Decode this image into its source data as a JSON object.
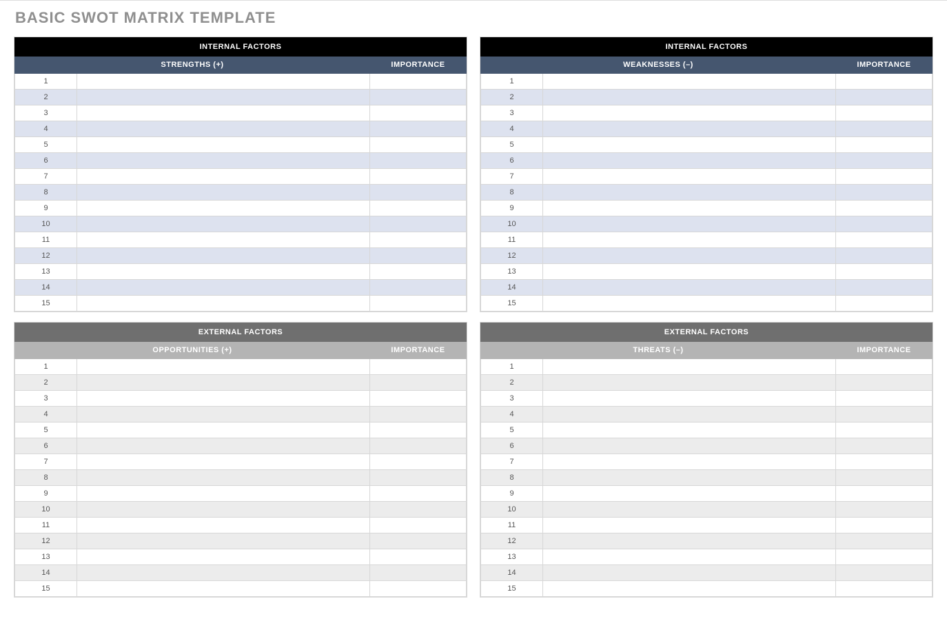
{
  "title": "BASIC SWOT MATRIX TEMPLATE",
  "row_count": 15,
  "quadrants": [
    {
      "id": "strengths",
      "section": "internal",
      "category_header": "INTERNAL FACTORS",
      "item_header": "STRENGTHS (+)",
      "importance_header": "IMPORTANCE"
    },
    {
      "id": "weaknesses",
      "section": "internal",
      "category_header": "INTERNAL FACTORS",
      "item_header": "WEAKNESSES (–)",
      "importance_header": "IMPORTANCE"
    },
    {
      "id": "opportunities",
      "section": "external",
      "category_header": "EXTERNAL FACTORS",
      "item_header": "OPPORTUNITIES (+)",
      "importance_header": "IMPORTANCE"
    },
    {
      "id": "threats",
      "section": "external",
      "category_header": "EXTERNAL FACTORS",
      "item_header": "THREATS (–)",
      "importance_header": "IMPORTANCE"
    }
  ]
}
